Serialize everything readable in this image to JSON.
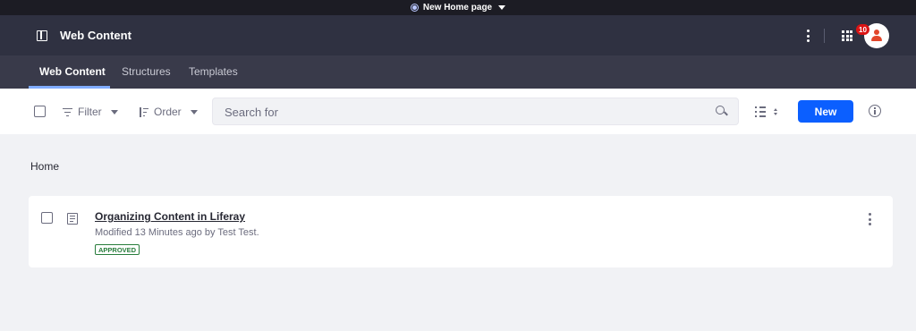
{
  "site_bar": {
    "page_name": "New Home page",
    "site_icon": "site-circle-icon"
  },
  "header": {
    "title": "Web Content",
    "notification_count": "10",
    "icons": [
      "sidebar-toggle-icon",
      "kebab-icon",
      "apps-grid-icon",
      "user-avatar-icon"
    ]
  },
  "tabs": [
    {
      "label": "Web Content",
      "active": true
    },
    {
      "label": "Structures",
      "active": false
    },
    {
      "label": "Templates",
      "active": false
    }
  ],
  "toolbar": {
    "filter_label": "Filter",
    "order_label": "Order",
    "search_placeholder": "Search for",
    "new_label": "New"
  },
  "breadcrumb": "Home",
  "items": [
    {
      "title": "Organizing Content in Liferay",
      "meta": "Modified 13 Minutes ago by Test Test.",
      "status": "APPROVED"
    }
  ],
  "colors": {
    "primary": "#0b5fff",
    "header_bg": "#2f3141",
    "tabs_bg": "#393a4a",
    "top_bar_bg": "#1c1c24",
    "approved": "#287d3c",
    "badge": "#da1414"
  }
}
